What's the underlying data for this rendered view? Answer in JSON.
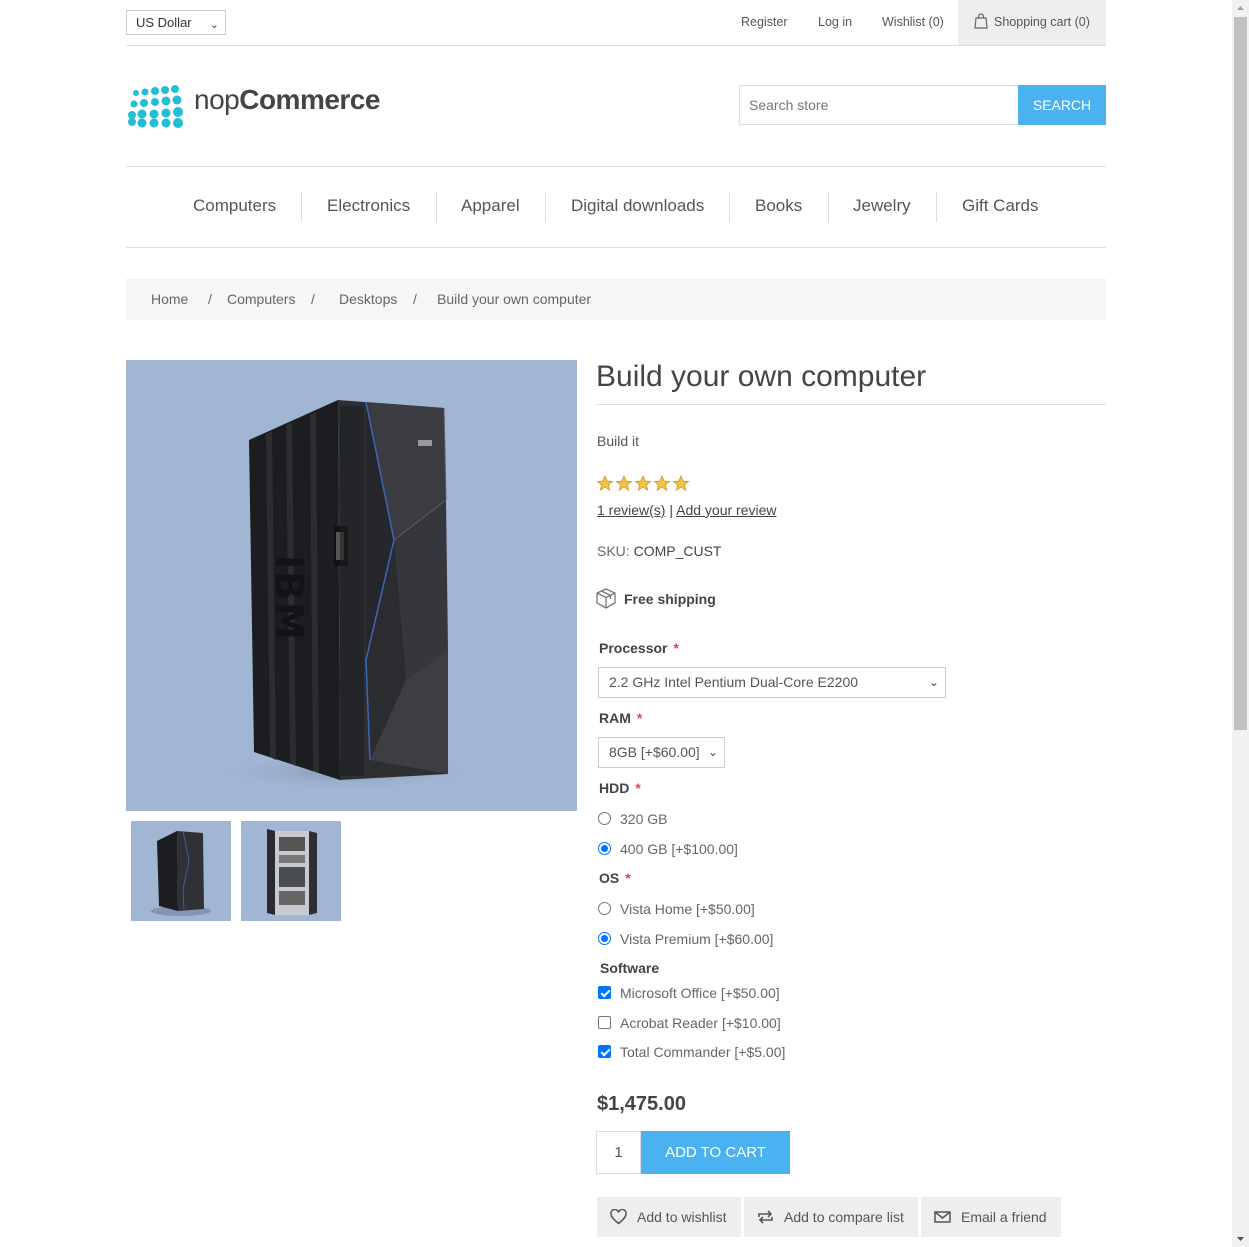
{
  "header": {
    "currency": "US Dollar",
    "links": {
      "register": "Register",
      "login": "Log in",
      "wishlist": "Wishlist (0)",
      "cart": "Shopping cart (0)"
    }
  },
  "logo": {
    "part1": "nop",
    "part2": "Commerce"
  },
  "search": {
    "placeholder": "Search store",
    "button": "SEARCH"
  },
  "nav": [
    "Computers",
    "Electronics",
    "Apparel",
    "Digital downloads",
    "Books",
    "Jewelry",
    "Gift Cards"
  ],
  "breadcrumb": {
    "home": "Home",
    "sep": "/",
    "computers": "Computers",
    "desktops": "Desktops",
    "current": "Build your own computer"
  },
  "product": {
    "title": "Build your own computer",
    "short_description": "Build it",
    "rating_stars": 5,
    "reviews_link": "1 review(s)",
    "review_sep": "|",
    "add_review": "Add your review",
    "sku_label": "SKU:",
    "sku_value": "COMP_CUST",
    "shipping": "Free shipping",
    "price": "$1,475.00",
    "quantity": "1",
    "add_to_cart": "ADD TO CART"
  },
  "attributes": {
    "required_mark": "*",
    "processor": {
      "label": "Processor",
      "selected": "2.2 GHz Intel Pentium Dual-Core E2200"
    },
    "ram": {
      "label": "RAM",
      "selected": "8GB [+$60.00]"
    },
    "hdd": {
      "label": "HDD",
      "options": [
        {
          "label": "320 GB",
          "checked": false
        },
        {
          "label": "400 GB [+$100.00]",
          "checked": true
        }
      ]
    },
    "os": {
      "label": "OS",
      "options": [
        {
          "label": "Vista Home [+$50.00]",
          "checked": false
        },
        {
          "label": "Vista Premium [+$60.00]",
          "checked": true
        }
      ]
    },
    "software": {
      "label": "Software",
      "options": [
        {
          "label": "Microsoft Office [+$50.00]",
          "checked": true
        },
        {
          "label": "Acrobat Reader [+$10.00]",
          "checked": false
        },
        {
          "label": "Total Commander [+$5.00]",
          "checked": true
        }
      ]
    }
  },
  "actions": {
    "wishlist": "Add to wishlist",
    "compare": "Add to compare list",
    "email": "Email a friend"
  },
  "colors": {
    "accent": "#4ab2f1",
    "logo_dots": "#22bdd6",
    "required": "#e4434b",
    "image_bg": "#a1b6d2"
  }
}
